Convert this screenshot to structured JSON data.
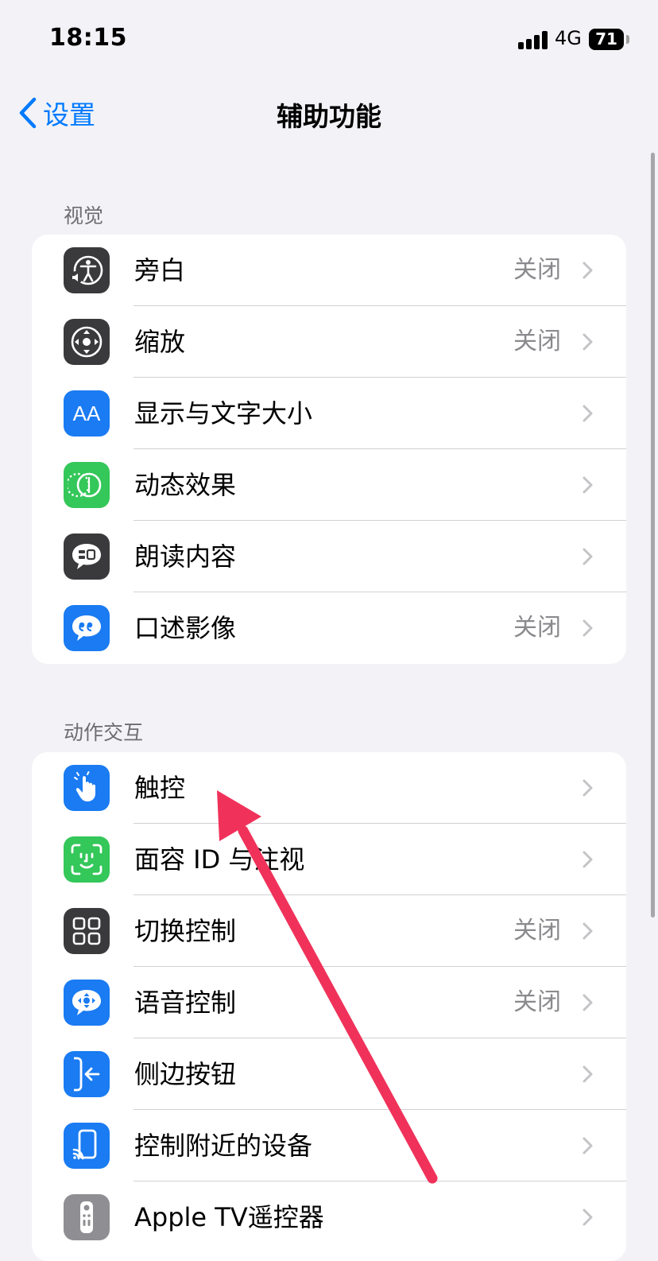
{
  "status_bar": {
    "time": "18:15",
    "network": "4G",
    "battery": "71",
    "battery_fraction": 0.71
  },
  "nav": {
    "back_label": "设置",
    "title": "辅助功能"
  },
  "sections": [
    {
      "header": "视觉",
      "rows": [
        {
          "label": "旁白",
          "value": "关闭",
          "icon": "voiceover-icon",
          "color": "#3a3a3c"
        },
        {
          "label": "缩放",
          "value": "关闭",
          "icon": "zoom-icon",
          "color": "#3a3a3c"
        },
        {
          "label": "显示与文字大小",
          "value": "",
          "icon": "text-size-icon",
          "icon_text": "AA",
          "color": "#1a7bf2"
        },
        {
          "label": "动态效果",
          "value": "",
          "icon": "motion-icon",
          "color": "#34c759"
        },
        {
          "label": "朗读内容",
          "value": "",
          "icon": "spoken-content-icon",
          "color": "#3a3a3c"
        },
        {
          "label": "口述影像",
          "value": "关闭",
          "icon": "audio-description-icon",
          "color": "#1a7bf2"
        }
      ]
    },
    {
      "header": "动作交互",
      "rows": [
        {
          "label": "触控",
          "value": "",
          "icon": "touch-hand-icon",
          "color": "#1a7bf2"
        },
        {
          "label": "面容 ID 与注视",
          "value": "",
          "icon": "face-id-icon",
          "color": "#34c759"
        },
        {
          "label": "切换控制",
          "value": "关闭",
          "icon": "switch-control-icon",
          "color": "#3a3a3c"
        },
        {
          "label": "语音控制",
          "value": "关闭",
          "icon": "voice-control-icon",
          "color": "#1a7bf2"
        },
        {
          "label": "侧边按钮",
          "value": "",
          "icon": "side-button-icon",
          "color": "#1a7bf2"
        },
        {
          "label": "控制附近的设备",
          "value": "",
          "icon": "nearby-devices-icon",
          "color": "#1a7bf2"
        },
        {
          "label": "Apple TV遥控器",
          "value": "",
          "icon": "apple-tv-remote-icon",
          "color": "#8e8e93"
        }
      ]
    }
  ],
  "colors": {
    "accent": "#007aff",
    "background": "#f2f2f7",
    "annotation": "#f0325a"
  }
}
